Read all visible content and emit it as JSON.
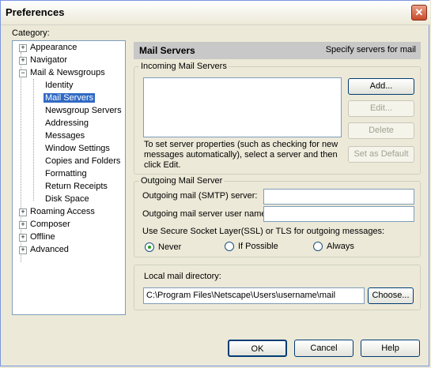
{
  "window": {
    "title": "Preferences",
    "close_glyph": "✕"
  },
  "category_label": "Category:",
  "tree": [
    {
      "label": "Appearance",
      "expander": "+",
      "level": 0
    },
    {
      "label": "Navigator",
      "expander": "+",
      "level": 0
    },
    {
      "label": "Mail & Newsgroups",
      "expander": "−",
      "level": 0
    },
    {
      "label": "Identity",
      "level": 1
    },
    {
      "label": "Mail Servers",
      "level": 1,
      "selected": true
    },
    {
      "label": "Newsgroup Servers",
      "level": 1
    },
    {
      "label": "Addressing",
      "level": 1
    },
    {
      "label": "Messages",
      "level": 1
    },
    {
      "label": "Window Settings",
      "level": 1
    },
    {
      "label": "Copies and Folders",
      "level": 1
    },
    {
      "label": "Formatting",
      "level": 1
    },
    {
      "label": "Return Receipts",
      "level": 1
    },
    {
      "label": "Disk Space",
      "level": 1
    },
    {
      "label": "Roaming Access",
      "expander": "+",
      "level": 0
    },
    {
      "label": "Composer",
      "expander": "+",
      "level": 0
    },
    {
      "label": "Offline",
      "expander": "+",
      "level": 0
    },
    {
      "label": "Advanced",
      "expander": "+",
      "level": 0
    }
  ],
  "panel": {
    "title": "Mail Servers",
    "description": "Specify servers for mail"
  },
  "incoming": {
    "legend": "Incoming Mail Servers",
    "help_text": "To set server properties (such as checking for new messages automatically), select a server and then click Edit.",
    "add_label": "Add...",
    "edit_label": "Edit...",
    "delete_label": "Delete",
    "default_label": "Set as Default"
  },
  "outgoing": {
    "legend": "Outgoing Mail Server",
    "smtp_label": "Outgoing mail (SMTP) server:",
    "smtp_value": "",
    "username_label": "Outgoing mail server user name:",
    "username_value": "",
    "ssl_label": "Use Secure Socket Layer(SSL) or TLS for outgoing messages:",
    "ssl_options": [
      "Never",
      "If Possible",
      "Always"
    ],
    "ssl_selected": "Never"
  },
  "local_dir": {
    "label": "Local mail directory:",
    "path": "C:\\Program Files\\Netscape\\Users\\username\\mail",
    "choose_label": "Choose..."
  },
  "footer": {
    "ok_label": "OK",
    "cancel_label": "Cancel",
    "help_label": "Help"
  }
}
